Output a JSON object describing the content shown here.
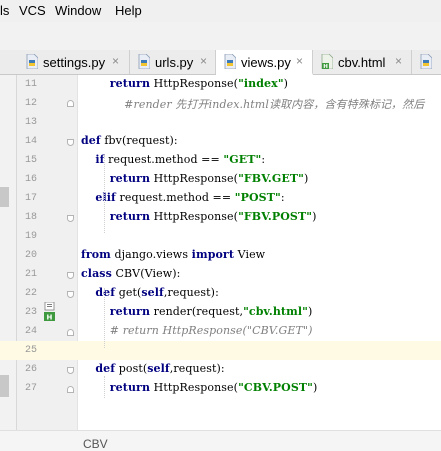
{
  "menu": [
    {
      "label": "ls"
    },
    {
      "label": "VCS"
    },
    {
      "label": "Window"
    },
    {
      "label": "Help"
    }
  ],
  "tabs": [
    {
      "label": "settings.py",
      "close": "×",
      "active": false
    },
    {
      "label": "urls.py",
      "close": "×",
      "active": false
    },
    {
      "label": "views.py",
      "close": "×",
      "active": true
    },
    {
      "label": "cbv.html",
      "close": "×",
      "active": false
    }
  ],
  "editor": {
    "lines": [
      {
        "num": "11",
        "segs": [
          [
            "pad",
            "        "
          ],
          [
            "kw",
            "return"
          ],
          [
            "t",
            " HttpResponse("
          ],
          [
            "str",
            "\"index\""
          ],
          [
            "t",
            ")"
          ]
        ]
      },
      {
        "num": "12",
        "segs": [
          [
            "pad",
            "            "
          ],
          [
            "cm",
            "#render 先打开index.html读取内容，含有特殊标记，然后"
          ]
        ]
      },
      {
        "num": "13",
        "segs": []
      },
      {
        "num": "14",
        "segs": [
          [
            "kw",
            "def"
          ],
          [
            "t",
            " fbv(request):"
          ]
        ]
      },
      {
        "num": "15",
        "segs": [
          [
            "pad",
            "    "
          ],
          [
            "kw",
            "if"
          ],
          [
            "t",
            " request.method == "
          ],
          [
            "str",
            "\"GET\""
          ],
          [
            "t",
            ":"
          ]
        ]
      },
      {
        "num": "16",
        "segs": [
          [
            "pad",
            "        "
          ],
          [
            "kw",
            "return"
          ],
          [
            "t",
            " HttpResponse("
          ],
          [
            "str",
            "\"FBV.GET\""
          ],
          [
            "t",
            ")"
          ]
        ]
      },
      {
        "num": "17",
        "segs": [
          [
            "pad",
            "    "
          ],
          [
            "kw",
            "elif"
          ],
          [
            "t",
            " request.method == "
          ],
          [
            "str",
            "\"POST\""
          ],
          [
            "t",
            ":"
          ]
        ]
      },
      {
        "num": "18",
        "segs": [
          [
            "pad",
            "        "
          ],
          [
            "kw",
            "return"
          ],
          [
            "t",
            " HttpResponse("
          ],
          [
            "str",
            "\"FBV.POST\""
          ],
          [
            "t",
            ")"
          ]
        ]
      },
      {
        "num": "19",
        "segs": []
      },
      {
        "num": "20",
        "segs": [
          [
            "kw",
            "from"
          ],
          [
            "t",
            " django.views "
          ],
          [
            "kw",
            "import"
          ],
          [
            "t",
            " View"
          ]
        ]
      },
      {
        "num": "21",
        "segs": [
          [
            "kw",
            "class"
          ],
          [
            "t",
            " CBV(View):"
          ]
        ]
      },
      {
        "num": "22",
        "segs": [
          [
            "pad",
            "    "
          ],
          [
            "kw",
            "def"
          ],
          [
            "t",
            " get("
          ],
          [
            "kw",
            "self"
          ],
          [
            "t",
            ",request):"
          ]
        ]
      },
      {
        "num": "23",
        "segs": [
          [
            "pad",
            "        "
          ],
          [
            "kw",
            "return"
          ],
          [
            "t",
            " render(request,"
          ],
          [
            "str",
            "\"cbv.html\""
          ],
          [
            "t",
            ")"
          ]
        ]
      },
      {
        "num": "24",
        "segs": [
          [
            "pad",
            "        "
          ],
          [
            "cm",
            "# return HttpResponse(\"CBV.GET\")"
          ]
        ]
      },
      {
        "num": "25",
        "segs": []
      },
      {
        "num": "26",
        "segs": [
          [
            "pad",
            "    "
          ],
          [
            "kw",
            "def"
          ],
          [
            "t",
            " post("
          ],
          [
            "kw",
            "self"
          ],
          [
            "t",
            ",request):"
          ]
        ]
      },
      {
        "num": "27",
        "segs": [
          [
            "pad",
            "        "
          ],
          [
            "kw",
            "return"
          ],
          [
            "t",
            " HttpResponse("
          ],
          [
            "str",
            "\"CBV.POST\""
          ],
          [
            "t",
            ")"
          ]
        ]
      }
    ]
  },
  "breadcrumb": "CBV",
  "colors": {
    "keyword": "#000080",
    "string": "#008000",
    "comment": "#808080",
    "current_line": "#fffae3"
  }
}
